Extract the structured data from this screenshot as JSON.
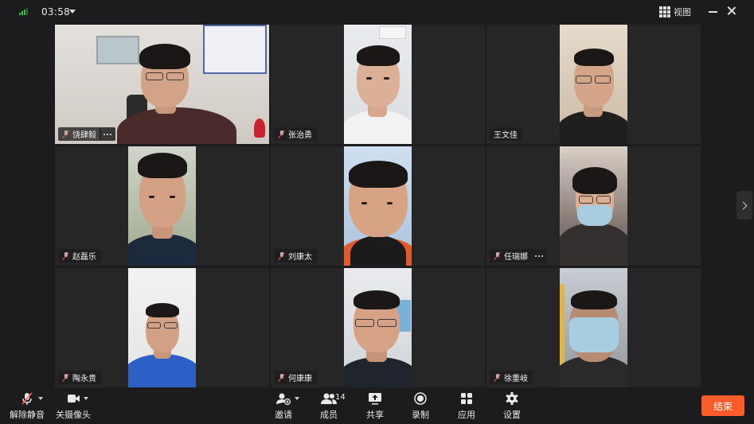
{
  "top_bar": {
    "timer": "03:58",
    "view_label": "视图"
  },
  "participants": [
    {
      "name": "饶肆毅",
      "has_more": true
    },
    {
      "name": "张治勇",
      "has_more": false
    },
    {
      "name": "王文佳",
      "has_more": false
    },
    {
      "name": "赵磊乐",
      "has_more": false
    },
    {
      "name": "刘康太",
      "has_more": false
    },
    {
      "name": "任瑞娜",
      "has_more": true
    },
    {
      "name": "陶永贵",
      "has_more": false
    },
    {
      "name": "何康康",
      "has_more": false
    },
    {
      "name": "徐重岐",
      "has_more": false
    }
  ],
  "toolbar": {
    "unmute_label": "解除静音",
    "camera_label": "关摄像头",
    "invite_label": "邀请",
    "members_label": "成员",
    "members_count": "14",
    "share_label": "共享",
    "record_label": "录制",
    "apps_label": "应用",
    "settings_label": "设置",
    "end_label": "结束"
  },
  "colors": {
    "background": "#1c1c1e",
    "tile": "#262626",
    "end_button": "#fe5b2b",
    "signal": "#32c24d"
  }
}
